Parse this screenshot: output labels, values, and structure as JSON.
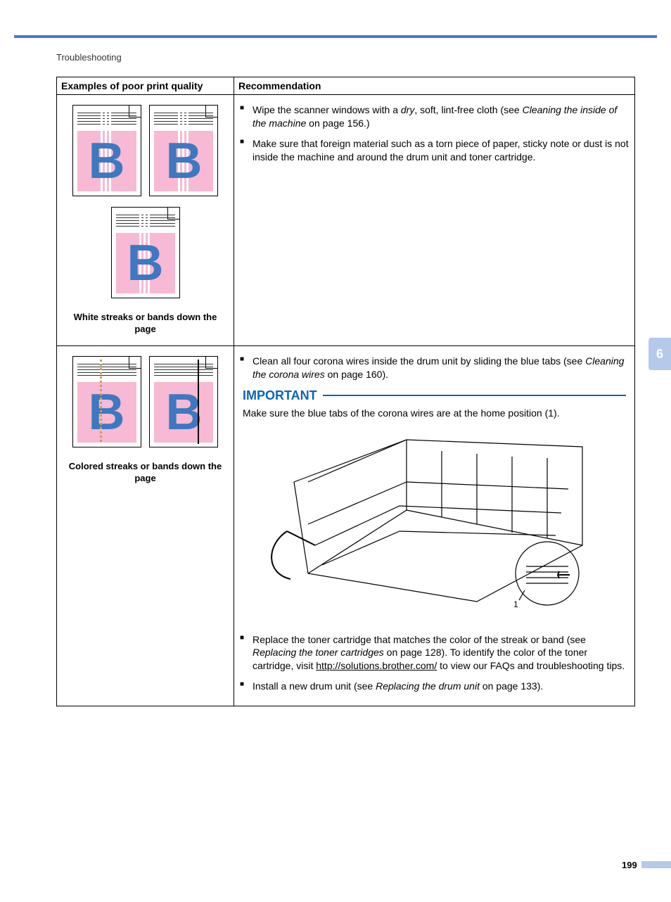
{
  "header": {
    "title": "Troubleshooting"
  },
  "side_tab": "6",
  "page_number": "199",
  "table": {
    "header_left": "Examples of poor print quality",
    "header_right": "Recommendation",
    "rows": [
      {
        "caption": "White streaks or bands down the page",
        "rec1_pre": "Wipe the scanner windows with a ",
        "rec1_em": "dry",
        "rec1_mid": ", soft, lint-free cloth (see ",
        "rec1_link": "Cleaning the inside of the machine",
        "rec1_post": " on page 156.)",
        "rec2": "Make sure that foreign material such as a torn piece of paper, sticky note or dust is not inside the machine and around the drum unit and toner cartridge."
      },
      {
        "caption": "Colored streaks or bands down the page",
        "rec1_pre": "Clean all four corona wires inside the drum unit by sliding the blue tabs (see ",
        "rec1_link": "Cleaning the corona wires",
        "rec1_post": " on page 160).",
        "important_label": "IMPORTANT",
        "important_text": "Make sure the blue tabs of the corona wires are at the home position (1).",
        "figure_label": "1",
        "rec2_pre": "Replace the toner cartridge that matches the color of the streak or band (see ",
        "rec2_link": "Replacing the toner cartridges",
        "rec2_mid": " on page 128). To identify the color of the toner cartridge, visit ",
        "rec2_url": "http://solutions.brother.com/",
        "rec2_post": " to view our FAQs and troubleshooting tips.",
        "rec3_pre": "Install a new drum unit (see ",
        "rec3_link": "Replacing the drum unit",
        "rec3_post": " on page 133)."
      }
    ]
  }
}
